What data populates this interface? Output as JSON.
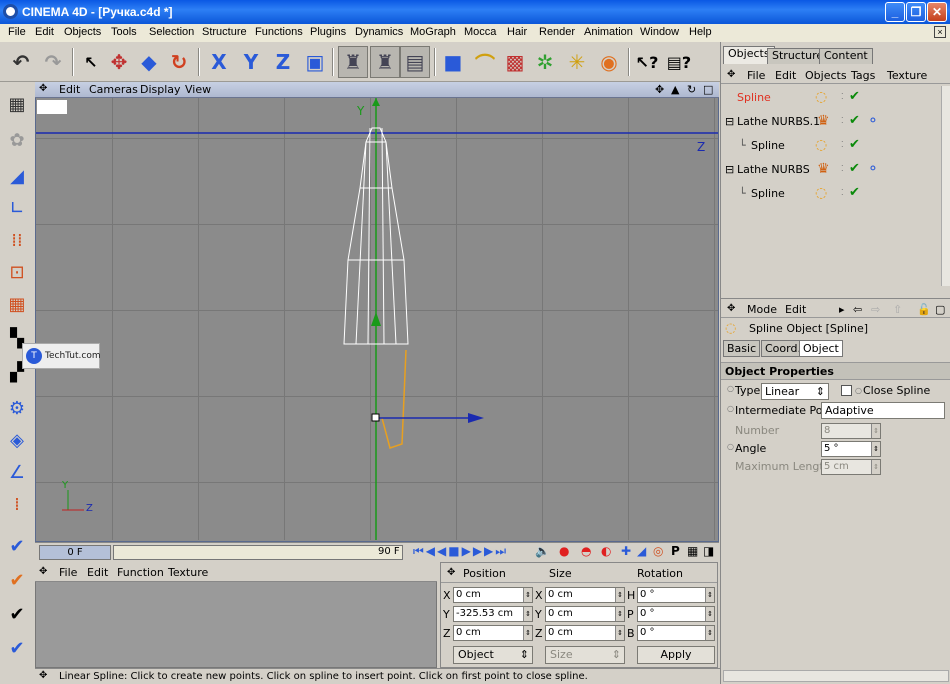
{
  "title": "CINEMA 4D - [Ручка.c4d *]",
  "menu": [
    "File",
    "Edit",
    "Objects",
    "Tools",
    "Selection",
    "Structure",
    "Functions",
    "Plugins",
    "Dynamics",
    "MoGraph",
    "Mocca",
    "Hair",
    "Render",
    "Animation",
    "Window",
    "Help"
  ],
  "viewport": {
    "menu": [
      "Edit",
      "Cameras",
      "Display",
      "View"
    ],
    "axis_y": "Y",
    "axis_z": "Z",
    "mini_axis_y": "Y",
    "mini_axis_z": "Z",
    "watermark": "TechTut.com"
  },
  "timeline": {
    "start": "0 F",
    "end": "90 F"
  },
  "materials": {
    "menu": [
      "File",
      "Edit",
      "Function",
      "Texture"
    ]
  },
  "coords": {
    "headers": [
      "Position",
      "Size",
      "Rotation"
    ],
    "rows": [
      {
        "p_label": "X",
        "p_val": "0 cm",
        "s_label": "X",
        "s_val": "0 cm",
        "r_label": "H",
        "r_val": "0 °"
      },
      {
        "p_label": "Y",
        "p_val": "-325.53 cm",
        "s_label": "Y",
        "s_val": "0 cm",
        "r_label": "P",
        "r_val": "0 °"
      },
      {
        "p_label": "Z",
        "p_val": "0 cm",
        "s_label": "Z",
        "s_val": "0 cm",
        "r_label": "B",
        "r_val": "0 °"
      }
    ],
    "mode_select": "Object",
    "size_select": "Size",
    "apply": "Apply"
  },
  "status": "Linear Spline: Click to create new points. Click on spline to insert point. Click on first point to close spline.",
  "objects": {
    "tabs": [
      "Objects",
      "Structure",
      "Content"
    ],
    "menu": [
      "File",
      "Edit",
      "Objects",
      "Tags",
      "Texture"
    ],
    "items": [
      {
        "name": "Spline",
        "indent": 0,
        "active": true
      },
      {
        "name": "Lathe NURBS.1",
        "indent": 0,
        "active": false
      },
      {
        "name": "Spline",
        "indent": 1,
        "active": false
      },
      {
        "name": "Lathe NURBS",
        "indent": 0,
        "active": false
      },
      {
        "name": "Spline",
        "indent": 1,
        "active": false
      }
    ]
  },
  "attributes": {
    "menu": [
      "Mode",
      "Edit"
    ],
    "title": "Spline Object [Spline]",
    "tabs": [
      "Basic",
      "Coord.",
      "Object"
    ],
    "section": "Object Properties",
    "type_label": "Type",
    "type_value": "Linear",
    "close_spline": "Close Spline",
    "inter_label": "Intermediate Points",
    "inter_value": "Adaptive",
    "number_label": "Number",
    "number_value": "8",
    "angle_label": "Angle",
    "angle_value": "5 °",
    "maxlen_label": "Maximum Length",
    "maxlen_value": "5 cm"
  },
  "colors": {
    "accent": "#0a58e4",
    "spline_active": "#e03020",
    "axis_y": "#1a9a1a",
    "axis_z": "#1a2ab0",
    "spline_orange": "#e8a020"
  }
}
